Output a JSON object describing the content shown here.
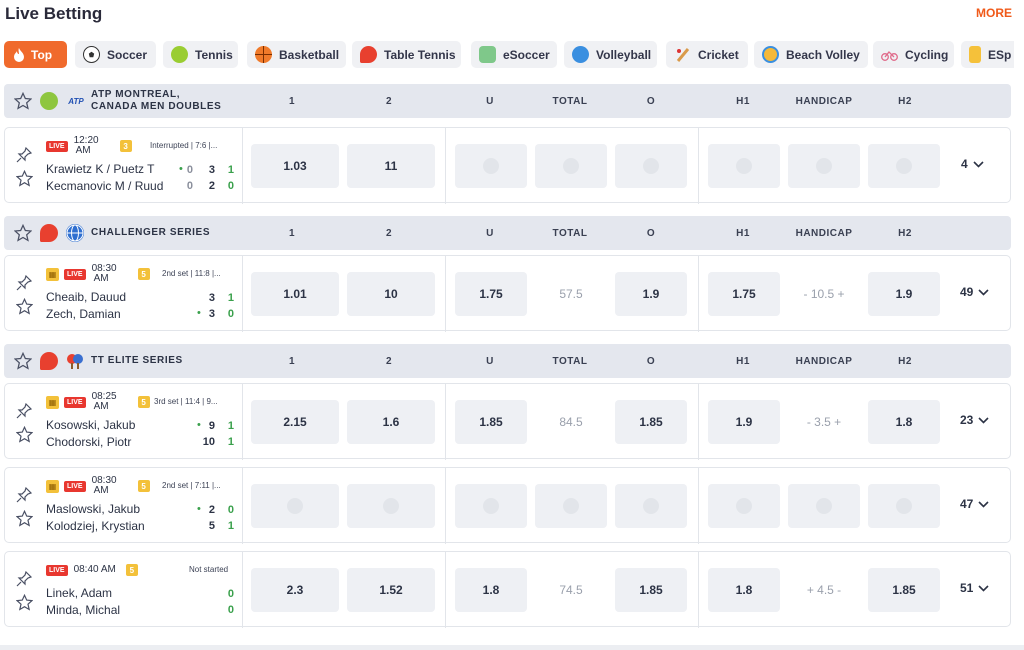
{
  "header": {
    "title": "Live Betting",
    "more": "MORE"
  },
  "tabs": [
    {
      "label": "Top",
      "icon": "fire-icon",
      "active": true
    },
    {
      "label": "Soccer",
      "icon": "soccer-ball-icon"
    },
    {
      "label": "Tennis",
      "icon": "tennis-ball-icon"
    },
    {
      "label": "Basketball",
      "icon": "basketball-icon"
    },
    {
      "label": "Table Tennis",
      "icon": "table-tennis-icon"
    },
    {
      "label": "eSoccer",
      "icon": "esoccer-icon"
    },
    {
      "label": "Volleyball",
      "icon": "volleyball-icon"
    },
    {
      "label": "Cricket",
      "icon": "cricket-icon"
    },
    {
      "label": "Beach Volley",
      "icon": "beach-volley-icon"
    },
    {
      "label": "Cycling",
      "icon": "cycling-icon"
    },
    {
      "label": "ESp",
      "icon": "esports-icon"
    }
  ],
  "columns": [
    "1",
    "2",
    "U",
    "TOTAL",
    "O",
    "H1",
    "HANDICAP",
    "H2"
  ],
  "leagues": [
    {
      "name_line1": "ATP MONTREAL,",
      "name_line2": "CANADA MEN DOUBLES",
      "badge": "ATP",
      "events": [
        {
          "live": "LIVE",
          "time_line1": "12:20",
          "time_line2": "AM",
          "set_badge": "3",
          "status": "Interrupted | 7:6 |...",
          "team1": "Krawietz K / Puetz T",
          "team2": "Kecmanovic M / Ruud",
          "serve1": true,
          "serve2": false,
          "t1_s1": "0",
          "t1_s2": "3",
          "t1_s3": "1",
          "t2_s1": "0",
          "t2_s2": "2",
          "t2_s3": "0",
          "odd1": "1.03",
          "odd2": "11",
          "u": "",
          "total": "",
          "o": "",
          "h1": "",
          "handicap": "",
          "h2": "",
          "locked_markets": true,
          "markets": "4"
        }
      ]
    },
    {
      "name_line1": "CHALLENGER SERIES",
      "name_line2": "",
      "events": [
        {
          "live": "LIVE",
          "time_line1": "08:30",
          "time_line2": "AM",
          "set_badge": "5",
          "status": "2nd set | 11:8 |...",
          "team1": "Cheaib, Dauud",
          "team2": "Zech, Damian",
          "serve1": false,
          "serve2": true,
          "t1_s2": "3",
          "t1_s3": "1",
          "t2_s2": "3",
          "t2_s3": "0",
          "odd1": "1.01",
          "odd2": "10",
          "u": "1.75",
          "total": "57.5",
          "o": "1.9",
          "h1": "1.75",
          "handicap": "- 10.5 +",
          "h2": "1.9",
          "locked_markets": false,
          "markets": "49"
        }
      ]
    },
    {
      "name_line1": "TT ELITE SERIES",
      "name_line2": "",
      "events": [
        {
          "live": "LIVE",
          "time_line1": "08:25",
          "time_line2": "AM",
          "set_badge": "5",
          "status": "3rd set | 11:4 | 9...",
          "team1": "Kosowski, Jakub",
          "team2": "Chodorski, Piotr",
          "serve1": true,
          "serve2": false,
          "t1_s2": "9",
          "t1_s3": "1",
          "t2_s2": "10",
          "t2_s3": "1",
          "odd1": "2.15",
          "odd2": "1.6",
          "u": "1.85",
          "total": "84.5",
          "o": "1.85",
          "h1": "1.9",
          "handicap": "- 3.5 +",
          "h2": "1.8",
          "locked_markets": false,
          "markets": "23"
        },
        {
          "live": "LIVE",
          "time_line1": "08:30",
          "time_line2": "AM",
          "set_badge": "5",
          "status": "2nd set | 7:11 |...",
          "team1": "Maslowski, Jakub",
          "team2": "Kolodziej, Krystian",
          "serve1": true,
          "serve2": false,
          "t1_s2": "2",
          "t1_s3": "0",
          "t2_s2": "5",
          "t2_s3": "1",
          "odd1": "",
          "odd2": "",
          "u": "",
          "total": "",
          "o": "",
          "h1": "",
          "handicap": "",
          "h2": "",
          "locked_markets": true,
          "locked_main": true,
          "markets": "47"
        },
        {
          "live": "LIVE",
          "time_line1": "08:40 AM",
          "time_line2": "",
          "set_badge": "5",
          "status": "Not started",
          "team1": "Linek, Adam",
          "team2": "Minda, Michal",
          "serve1": false,
          "serve2": false,
          "t1_s3": "0",
          "t2_s3": "0",
          "odd1": "2.3",
          "odd2": "1.52",
          "u": "1.8",
          "total": "74.5",
          "o": "1.85",
          "h1": "1.8",
          "handicap": "+ 4.5 -",
          "h2": "1.85",
          "locked_markets": false,
          "markets": "51"
        }
      ]
    }
  ]
}
